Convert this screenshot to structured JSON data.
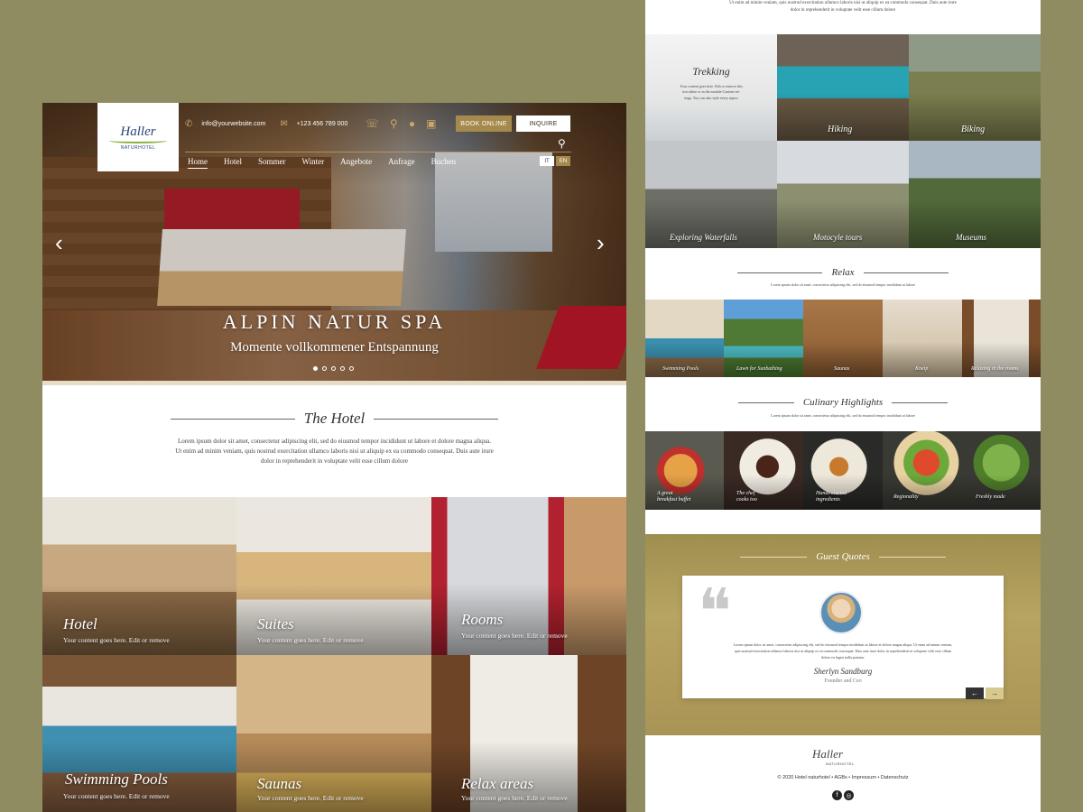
{
  "header": {
    "logo_text": "Haller",
    "logo_sub": "NATURHOTEL",
    "email": "info@yourwebsite.com",
    "phone": "+123 456 789 000",
    "book_label": "BOOK ONLINE",
    "inquire_label": "INQUIRE",
    "nav": [
      "Home",
      "Hotel",
      "Sommer",
      "Winter",
      "Angebote",
      "Anfrage",
      "Buchen"
    ],
    "lang": [
      "IT",
      "EN"
    ]
  },
  "hero": {
    "title": "ALPIN NATUR SPA",
    "subtitle": "Momente vollkommener Entspannung",
    "slides": 5,
    "active_slide": 1
  },
  "hotel_section": {
    "title": "The Hotel",
    "lines": [
      "Lorem ipsum dolor sit amet, consectetur adipiscing elit, sed do eiusmod tempor incididunt ut labore et dolore magna aliqua.",
      "Ut enim ad minim veniam, quis nostrud exercitation ullamco laboris nisi ut aliquip ex ea commodo consequat. Duis aute irure",
      "dolor in reprehenderit in voluptate velit esse cillum dolore"
    ]
  },
  "tiles": [
    {
      "title": "Hotel",
      "text": "Your content goes here. Edit or remove"
    },
    {
      "title": "Suites",
      "text": "Your content goes here. Edit or remove"
    },
    {
      "title": "Rooms",
      "text": "Your content goes here. Edit or remove"
    },
    {
      "title": "Swimming Pools",
      "text": "Your content goes here. Edit or remove"
    },
    {
      "title": "Saunas",
      "text": "Your content goes here. Edit or remove"
    },
    {
      "title": "Relax areas",
      "text": "Your content goes here. Edit or remove"
    }
  ],
  "right": {
    "top_lines": [
      "Ut enim ad minim veniam, quis nostrud exercitation ullamco laboris nisi ut aliquip ex ea commodo consequat. Duis aute irure",
      "dolor in reprehenderit in voluptate velit esse cillum dolore"
    ],
    "trekking": {
      "title": "Trekking",
      "lines": [
        "Your content goes here. Edit or remove this",
        "text inline or in the module Content set-",
        "tings. You can also style every aspect"
      ]
    },
    "activities": [
      "Hiking",
      "Biking",
      "Exploring Waterfalls",
      "Motocyle tours",
      "Museums"
    ],
    "relax": {
      "title": "Relax",
      "line": "Lorem ipsum dolor sit amet, consectetur adipiscing elit, sed do eiusmod tempor incididunt ut labore",
      "items": [
        "Swimming Pools",
        "Lawn for Sunbathing",
        "Saunas",
        "Kneip",
        "Relaxing in the rooms"
      ]
    },
    "culinary": {
      "title": "Culinary Highlights",
      "line": "Lorem ipsum dolor sit amet, consectetur adipiscing elit, sed do eiusmod tempor incididunt ut labore",
      "items": [
        [
          "A great",
          "breakfast buffet"
        ],
        [
          "The chef",
          "cooks too"
        ],
        [
          "Hands elected",
          "ingredients"
        ],
        [
          "Regionality",
          ""
        ],
        [
          "Freshly made",
          ""
        ]
      ]
    },
    "quotes": {
      "title": "Guest Quotes",
      "lines": [
        "Lorem ipsum dolor sit amet, consectetur adipiscing elit, sed do eiusmod tempor incididunt ut labore et dolore magna aliqua. Ut enim ad minim veniam,",
        "quis nostrud exercitation ullamco laboris nisi ut aliquip ex ea commodo consequat. Duis aute irure dolor in reprehenderit in voluptate velit esse cillum",
        "dolore eu fugiat nulla pariatur."
      ],
      "name": "Sherlyn Sandburg",
      "role": "Founder and Ceo",
      "prev": "←",
      "next": "→"
    },
    "footer": {
      "logo": "Haller",
      "logo_sub": "NATURHOTEL",
      "text": "© 2020 Hotel naturhotel • AGBs • Impressum • Datenschutz",
      "social": [
        "f",
        "◎"
      ]
    }
  },
  "colors": {
    "background": "#8f8c62",
    "gold": "#a6894c",
    "logo_blue": "#27457a",
    "logo_green": "#8bb03a"
  },
  "icons": [
    "phone-icon",
    "mail-icon",
    "whatsapp-icon",
    "map-pin-icon",
    "chat-icon",
    "gift-icon",
    "search-icon",
    "facebook-icon",
    "instagram-icon"
  ]
}
